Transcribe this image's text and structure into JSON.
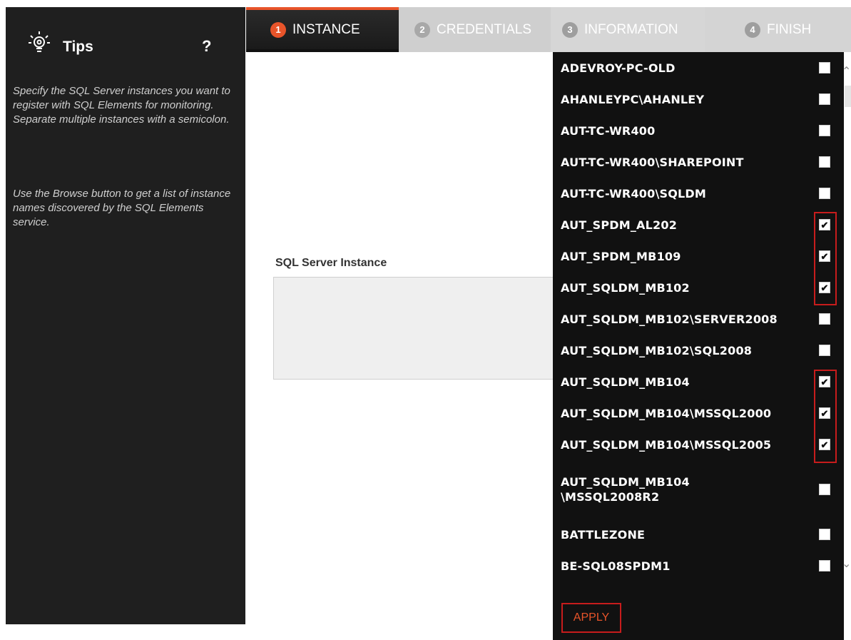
{
  "tips": {
    "title": "Tips",
    "help": "?",
    "paragraph1": "Specify the SQL Server instances you want to register with SQL Elements for monitoring. Separate multiple instances with a semicolon.",
    "paragraph2": "Use the Browse button to get a list of instance names discovered by the SQL Elements service."
  },
  "tabs": [
    {
      "num": "1",
      "label": "INSTANCE"
    },
    {
      "num": "2",
      "label": "CREDENTIALS"
    },
    {
      "num": "3",
      "label": "INFORMATION"
    },
    {
      "num": "4",
      "label": "FINISH"
    }
  ],
  "main": {
    "field_label": "SQL Server Instance",
    "field_value": ""
  },
  "instances": [
    {
      "name": "ADEVROY-PC-OLD",
      "checked": false
    },
    {
      "name": "AHANLEYPC\\AHANLEY",
      "checked": false
    },
    {
      "name": "AUT-TC-WR400",
      "checked": false
    },
    {
      "name": "AUT-TC-WR400\\SHAREPOINT",
      "checked": false
    },
    {
      "name": "AUT-TC-WR400\\SQLDM",
      "checked": false
    },
    {
      "name": "AUT_SPDM_AL202",
      "checked": true
    },
    {
      "name": "AUT_SPDM_MB109",
      "checked": true
    },
    {
      "name": "AUT_SQLDM_MB102",
      "checked": true
    },
    {
      "name": "AUT_SQLDM_MB102\\SERVER2008",
      "checked": false
    },
    {
      "name": "AUT_SQLDM_MB102\\SQL2008",
      "checked": false
    },
    {
      "name": "AUT_SQLDM_MB104",
      "checked": true
    },
    {
      "name": "AUT_SQLDM_MB104\\MSSQL2000",
      "checked": true
    },
    {
      "name": "AUT_SQLDM_MB104\\MSSQL2005",
      "checked": true
    },
    {
      "name": "AUT_SQLDM_MB104\n\\MSSQL2008R2",
      "checked": false
    },
    {
      "name": "BATTLEZONE",
      "checked": false
    },
    {
      "name": "BE-SQL08SPDM1",
      "checked": false
    }
  ],
  "apply_label": "APPLY",
  "colors": {
    "accent": "#e8542a",
    "highlight": "#c71c1c",
    "dark": "#111111"
  }
}
